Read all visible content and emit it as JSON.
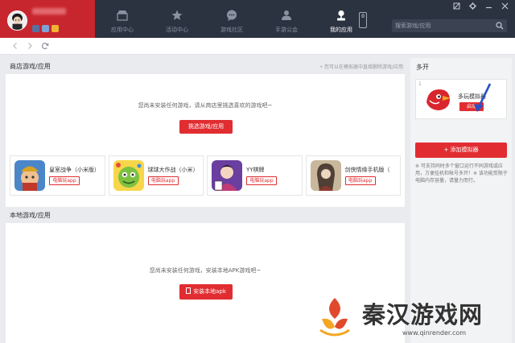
{
  "nav": {
    "items": [
      {
        "label": "应用中心",
        "icon": "store-icon"
      },
      {
        "label": "活动中心",
        "icon": "star-icon"
      },
      {
        "label": "游戏社区",
        "icon": "chat-icon"
      },
      {
        "label": "手游公会",
        "icon": "guild-icon"
      },
      {
        "label": "我的应用",
        "icon": "joystick-icon",
        "active": true
      }
    ],
    "phone_count": "0"
  },
  "search": {
    "placeholder": "搜索游戏/应用"
  },
  "store_section": {
    "title": "商店游戏/应用",
    "hint": "• 您可以在模拟器中直接删除游戏/应用",
    "empty_text": "您尚未安装任何游戏，请从商店里挑选喜欢的游戏吧~",
    "button_label": "挑选游戏/应用",
    "games": [
      {
        "name": "皇室战争（小米版）",
        "tag": "电脑玩app"
      },
      {
        "name": "球球大作战（小米）",
        "tag": "电脑玩app"
      },
      {
        "name": "YY棋牌",
        "tag": "电脑玩app"
      },
      {
        "name": "剑侠情缘手机版（",
        "tag": "电脑玩app"
      }
    ]
  },
  "local_section": {
    "title": "本地游戏/应用",
    "empty_text": "您尚未安装任何游戏，安装本地APK游戏吧~",
    "button_label": "安装本地apk"
  },
  "multi": {
    "title": "多开",
    "card": {
      "index": "1",
      "name": "多玩模拟器",
      "start_label": "启动"
    },
    "add_label": "+ 添加模拟器",
    "notes": "※ 可支持同时多个窗口运行不同游戏或应用，方便挂机和帐号多开！※ 该功能受限于电脑内存容量，请量力而行。"
  },
  "watermark": {
    "text": "秦汉游戏网",
    "url": "www.qinrender.com"
  },
  "colors": {
    "accent": "#e12d31",
    "topbar": "#2b3240",
    "profile": "#c8262e"
  }
}
